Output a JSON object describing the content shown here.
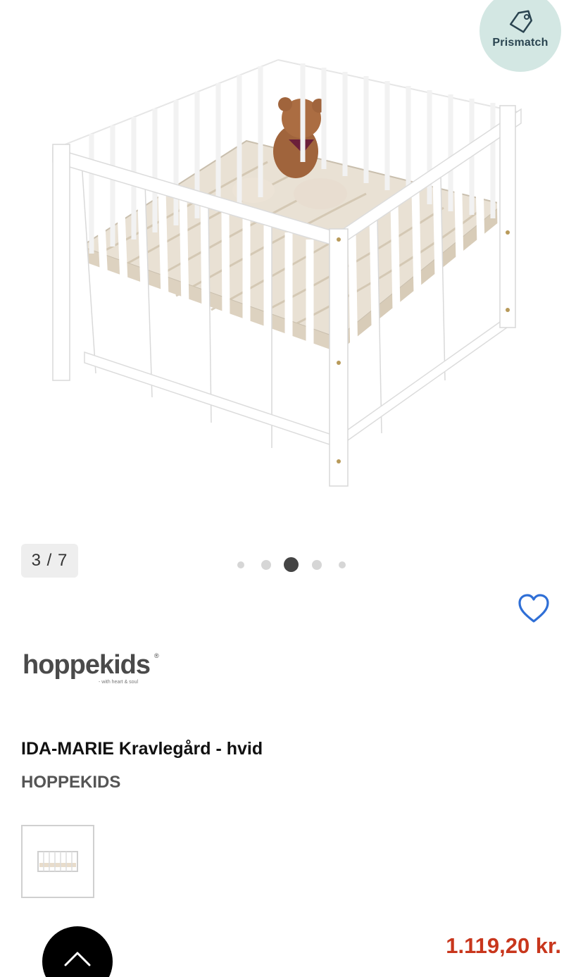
{
  "prismatch": {
    "label": "Prismatch",
    "icon": "price-tag-icon"
  },
  "gallery": {
    "counter": "3 / 7",
    "current": 3,
    "total": 7,
    "active_dot": 2,
    "dot_count": 5
  },
  "favorite": {
    "icon": "heart-icon",
    "color": "#2f6fd6"
  },
  "brand_logo": {
    "text": "hoppekids",
    "tagline": "- with heart & soul",
    "trademark": "®"
  },
  "product": {
    "title": "IDA-MARIE Kravlegård - hvid",
    "brand": "HOPPEKIDS",
    "price": "1.119,20 kr."
  },
  "scroll_top": {
    "icon": "chevron-up-icon"
  },
  "colors": {
    "price": "#c8361c",
    "prismatch_bg": "#d3e7e3",
    "dot_active": "#444444",
    "dot_inactive": "#d6d6d6"
  }
}
